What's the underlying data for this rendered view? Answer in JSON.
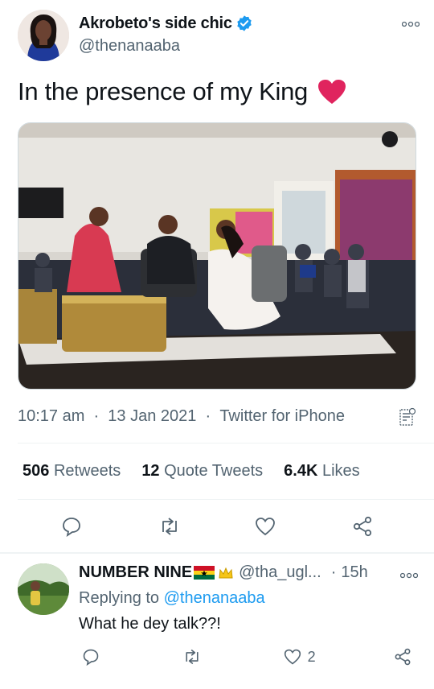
{
  "tweet": {
    "author": {
      "display_name": "Akrobeto's side chic",
      "handle": "@thenanaaba",
      "verified": true
    },
    "text": "In the presence of my King",
    "emoji": "red-heart",
    "timestamp": {
      "time": "10:17 am",
      "date": "13 Jan 2021",
      "source": "Twitter for iPhone"
    },
    "stats": {
      "retweets_count": "506",
      "retweets_label": "Retweets",
      "quotes_count": "12",
      "quotes_label": "Quote Tweets",
      "likes_count": "6.4K",
      "likes_label": "Likes"
    },
    "actions": [
      "reply-icon",
      "retweet-icon",
      "like-icon",
      "share-icon"
    ]
  },
  "reply": {
    "display_name": "NUMBER NINE",
    "handle": "@tha_ugl...",
    "separator": "·",
    "time": "15h",
    "replying_prefix": "Replying to",
    "replying_to": "@thenanaaba",
    "text": "What he dey talk??!",
    "likes": "2"
  },
  "colors": {
    "accent": "#1d9bf0",
    "secondary_text": "#536471",
    "primary_text": "#0f1419",
    "like_heart": "#e0245e"
  }
}
